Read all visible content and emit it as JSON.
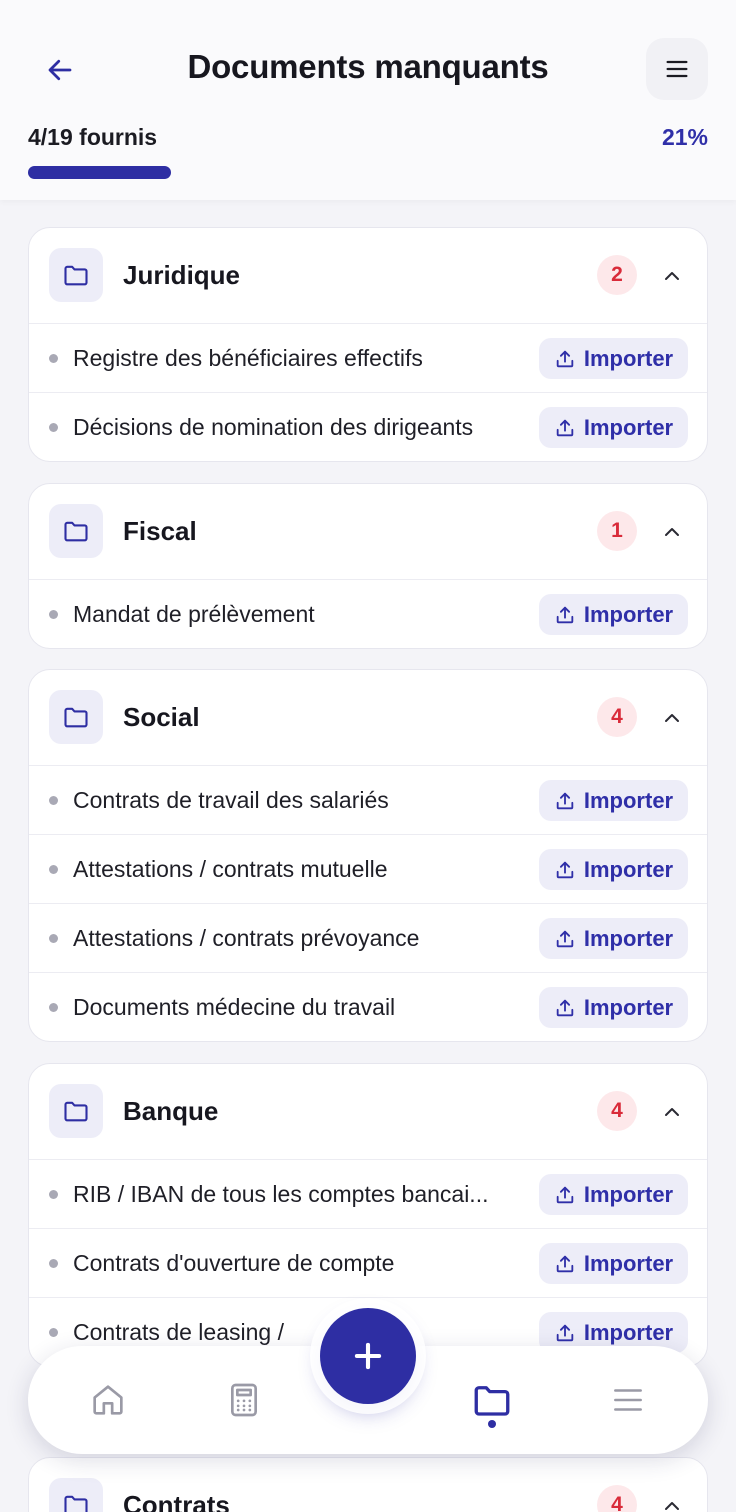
{
  "header": {
    "title": "Documents manquants",
    "progress_label": "4/19 fournis",
    "progress_percent_label": "21%",
    "progress_value": 0.21
  },
  "sections": [
    {
      "title": "Juridique",
      "count": "2",
      "items": [
        {
          "label": "Registre des bénéficiaires effectifs",
          "action": "Importer"
        },
        {
          "label": "Décisions de nomination des dirigeants",
          "action": "Importer"
        }
      ]
    },
    {
      "title": "Fiscal",
      "count": "1",
      "items": [
        {
          "label": "Mandat de prélèvement",
          "action": "Importer"
        }
      ]
    },
    {
      "title": "Social",
      "count": "4",
      "items": [
        {
          "label": "Contrats de travail des salariés",
          "action": "Importer"
        },
        {
          "label": "Attestations / contrats mutuelle",
          "action": "Importer"
        },
        {
          "label": "Attestations / contrats prévoyance",
          "action": "Importer"
        },
        {
          "label": "Documents médecine du travail",
          "action": "Importer"
        }
      ]
    },
    {
      "title": "Banque",
      "count": "4",
      "items": [
        {
          "label": "RIB / IBAN de tous les comptes bancai...",
          "action": "Importer"
        },
        {
          "label": "Contrats d'ouverture de compte",
          "action": "Importer"
        },
        {
          "label": "Contrats de leasing /",
          "action": "Importer"
        }
      ]
    },
    {
      "title": "Contrats",
      "count": "4",
      "items": []
    }
  ],
  "nav": {
    "items": [
      {
        "icon": "home-icon"
      },
      {
        "icon": "calculator-icon"
      },
      {
        "icon": "folder-icon",
        "active": true
      },
      {
        "icon": "menu-icon"
      }
    ],
    "fab_icon": "plus-icon"
  },
  "colors": {
    "accent": "#2e2ea3",
    "badge_bg": "#fde8ea",
    "badge_text": "#d92b3a",
    "chip_bg": "#ededf8",
    "page_bg": "#f4f4f8"
  }
}
